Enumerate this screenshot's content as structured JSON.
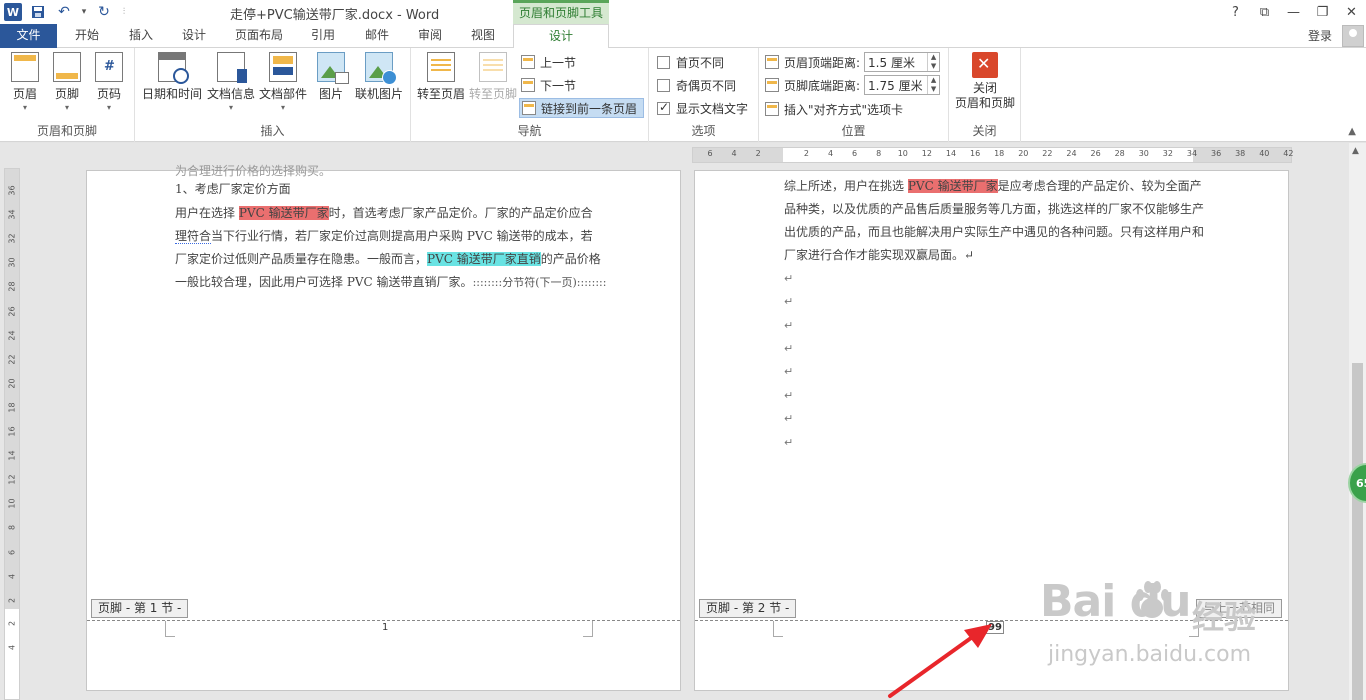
{
  "titlebar": {
    "app_icon_letter": "W",
    "document_title": "走停+PVC输送带厂家.docx - Word",
    "contextual_tools_label": "页眉和页脚工具",
    "window_buttons": [
      "?",
      "⧉",
      "—",
      "❐",
      "✕"
    ]
  },
  "tabs": {
    "file": "文件",
    "home": "开始",
    "insert": "插入",
    "design": "设计",
    "layout": "页面布局",
    "references": "引用",
    "mailings": "邮件",
    "review": "审阅",
    "view": "视图",
    "hf_design": "设计",
    "login": "登录"
  },
  "ribbon": {
    "hf_group": {
      "label": "页眉和页脚",
      "header": "页眉",
      "footer": "页脚",
      "page_number": "页码"
    },
    "insert_group": {
      "label": "插入",
      "date_time": "日期和时间",
      "doc_info": "文档信息",
      "doc_parts": "文档部件",
      "picture": "图片",
      "online_picture": "联机图片"
    },
    "nav_group": {
      "label": "导航",
      "goto_header": "转至页眉",
      "goto_footer": "转至页脚",
      "previous": "上一节",
      "next": "下一节",
      "link_previous": "链接到前一条页眉"
    },
    "options_group": {
      "label": "选项",
      "different_first": "首页不同",
      "different_odd_even": "奇偶页不同",
      "show_doc_text": "显示文档文字",
      "show_doc_text_checked": true
    },
    "position_group": {
      "label": "位置",
      "header_top_label": "页眉顶端距离:",
      "header_top_value": "1.5 厘米",
      "footer_bottom_label": "页脚底端距离:",
      "footer_bottom_value": "1.75 厘米",
      "insert_align_tab": "插入\"对齐方式\"选项卡"
    },
    "close_group": {
      "label": "关闭",
      "close_line1": "关闭",
      "close_line2": "页眉和页脚"
    }
  },
  "ruler": {
    "horizontal_labels": [
      "6",
      "4",
      "2",
      "",
      "2",
      "4",
      "6",
      "8",
      "10",
      "12",
      "14",
      "16",
      "18",
      "20",
      "22",
      "24",
      "26",
      "28",
      "30",
      "32",
      "34",
      "36",
      "38",
      "40",
      "42"
    ],
    "vertical_labels": [
      "36",
      "34",
      "32",
      "30",
      "28",
      "26",
      "24",
      "22",
      "20",
      "18",
      "16",
      "14",
      "12",
      "10",
      "8",
      "6",
      "4",
      "2",
      "2",
      "4"
    ]
  },
  "page1": {
    "line0": "为合理进行价格的选择购买。",
    "line1": "1、考虑厂家定价方面",
    "line2_pre": "用户在选择 ",
    "line2_hl": "PVC 输送带厂家",
    "line2_post": "时，首选考虑厂家产品定价。厂家的产品定价应合",
    "line3_sq": "理符合",
    "line3_post": "当下行业行情，若厂家定价过高则提高用户采购 PVC 输送带的成本，若",
    "line4_pre": "厂家定价过低则产品质量存在隐患。一般而言，",
    "line4_hl": "PVC 输送带厂家直销",
    "line4_post": "的产品价格",
    "line5": "一般比较合理，因此用户可选择 PVC 输送带直销厂家。",
    "section_break": "::::::::分节符(下一页)::::::::",
    "footer_tag": "页脚 - 第 1 节 -",
    "page_number": "1"
  },
  "page2": {
    "line1_pre": "综上所述，用户在挑选 ",
    "line1_hl": "PVC 输送带厂家",
    "line1_post": "是应考虑合理的产品定价、较为全面产",
    "line2": "品种类，以及优质的产品售后质量服务等几方面，挑选这样的厂家不仅能够生产",
    "line3": "出优质的产品，而且也能解决用户实际生产中遇见的各种问题。只有这样用户和",
    "line4": "厂家进行合作才能实现双赢局面。↵",
    "para_mark": "↵",
    "footer_tag": "页脚 - 第 2 节 -",
    "same_as_prev_tag": "与上一节相同",
    "page_number_field": "99"
  },
  "overlay": {
    "side_badge": "65",
    "watermark_brand": "Bai  du",
    "watermark_cn": "经验",
    "watermark_url": "jingyan.baidu.com"
  },
  "colors": {
    "word_blue": "#2b579a",
    "tools_green": "#5aa55a",
    "highlight_red": "#ea6f6f",
    "highlight_cyan": "#69e3e3",
    "annotation_arrow": "#e8262b"
  }
}
